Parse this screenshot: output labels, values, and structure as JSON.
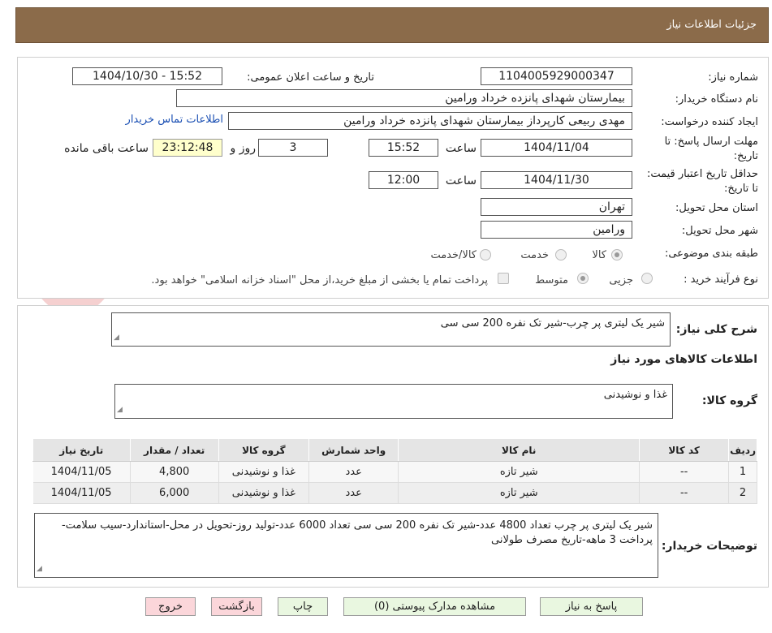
{
  "header": {
    "title": "جزئیات اطلاعات نیاز"
  },
  "watermark": {
    "text": "AriaTender.neT"
  },
  "form": {
    "need_number": {
      "label": "شماره نیاز:",
      "value": "1104005929000347"
    },
    "announce_date": {
      "label": "تاریخ و ساعت اعلان عمومی:",
      "value": "1404/10/30 - 15:52"
    },
    "buyer_org": {
      "label": "نام دستگاه خریدار:",
      "value": "بیمارستان شهدای پانزده خرداد ورامین"
    },
    "requester": {
      "label": "ایجاد کننده درخواست:",
      "value": "مهدی ربیعی کارپرداز بیمارستان شهدای پانزده خرداد ورامین"
    },
    "contact_link": "اطلاعات تماس خریدار",
    "deadline": {
      "label": "مهلت ارسال پاسخ: تا تاریخ:",
      "date": "1404/11/04",
      "time_label": "ساعت",
      "time": "15:52",
      "days": "3",
      "days_label": "روز و",
      "remaining": "23:12:48",
      "remaining_label": "ساعت باقی مانده"
    },
    "validity": {
      "label": "حداقل تاریخ اعتبار قیمت: تا تاریخ:",
      "date": "1404/11/30",
      "time_label": "ساعت",
      "time": "12:00"
    },
    "province": {
      "label": "استان محل تحویل:",
      "value": "تهران"
    },
    "city": {
      "label": "شهر محل تحویل:",
      "value": "ورامین"
    },
    "category": {
      "label": "طبقه بندی موضوعی:",
      "options": [
        "کالا",
        "خدمت",
        "کالا/خدمت"
      ],
      "selected": "کالا"
    },
    "process": {
      "label": "نوع فرآیند خرید :",
      "options": [
        "جزیی",
        "متوسط"
      ],
      "selected": "متوسط",
      "treasury_note": "پرداخت تمام یا بخشی از مبلغ خرید،از محل \"اسناد خزانه اسلامی\" خواهد بود."
    }
  },
  "summary": {
    "label": "شرح کلی نیاز:",
    "value": "شیر یک لیتری پر چرب-شیر تک نفره 200 سی سی"
  },
  "items_section": {
    "title": "اطلاعات کالاهای مورد نیاز",
    "group_label": "گروه کالا:",
    "group_value": "غذا و نوشیدنی"
  },
  "table": {
    "headers": [
      "ردیف",
      "کد کالا",
      "نام کالا",
      "واحد شمارش",
      "گروه کالا",
      "تعداد / مقدار",
      "تاریخ نیاز"
    ],
    "rows": [
      [
        "1",
        "--",
        "شیر تازه",
        "عدد",
        "غذا و نوشیدنی",
        "4,800",
        "1404/11/05"
      ],
      [
        "2",
        "--",
        "شیر تازه",
        "عدد",
        "غذا و نوشیدنی",
        "6,000",
        "1404/11/05"
      ]
    ]
  },
  "buyer_notes": {
    "label": "توضیحات خریدار:",
    "value": "شیر یک لیتری پر چرب تعداد 4800 عدد-شیر تک نفره 200 سی سی تعداد 6000 عدد-تولید روز-تحویل در محل-استاندارد-سیب سلامت-پرداخت 3 ماهه-تاریخ مصرف طولانی"
  },
  "buttons": {
    "reply": "پاسخ به نیاز",
    "attachments": "مشاهده مدارک پیوستی (0)",
    "print": "چاپ",
    "back": "بازگشت",
    "exit": "خروج"
  },
  "colors": {
    "header_bg": "#8b6b4a",
    "button_green": "#e9f7e0",
    "button_red": "#fbd6da",
    "link": "#1a4fb3"
  }
}
